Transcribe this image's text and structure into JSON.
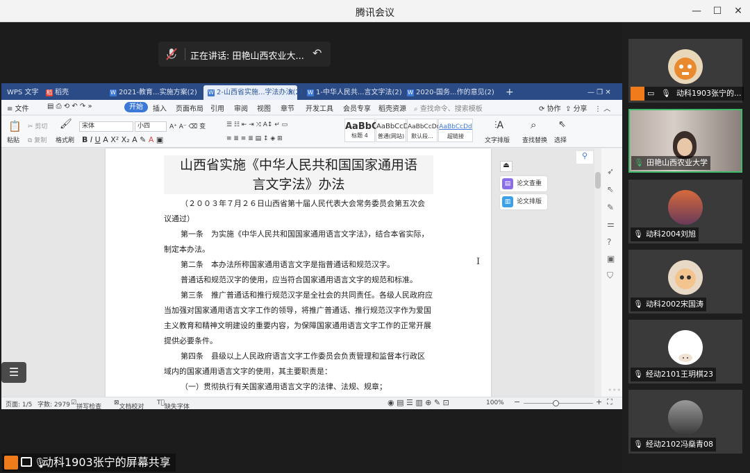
{
  "window": {
    "title": "腾讯会议",
    "minimize": "—",
    "maximize": "☐",
    "close": "✕"
  },
  "speaking": {
    "label": "正在讲话: 田艳山西农业大..."
  },
  "wps": {
    "tabs": [
      {
        "label": "WPS 文字"
      },
      {
        "label": "稻壳"
      },
      {
        "label": "2021-教育...实施方案(2)"
      },
      {
        "label": "2-山西省实施...字法办法(2)"
      },
      {
        "label": "1-中华人民共...言文字法(2)"
      },
      {
        "label": "2020-国务...作的意见(2)"
      }
    ],
    "menu": {
      "file": "≡ 文件",
      "items": [
        "开始",
        "插入",
        "页面布局",
        "引用",
        "审阅",
        "视图",
        "章节",
        "开发工具",
        "会员专享",
        "稻壳资源"
      ],
      "search": "查找命令、搜索模板",
      "collab": "协作",
      "share": "分享"
    },
    "ribbon": {
      "paste": "粘贴",
      "cut": "剪切",
      "copy": "复制",
      "format_painter": "格式刷",
      "font": "宋体",
      "size": "小四",
      "styles": [
        {
          "sample": "AaBbC",
          "name": "标题 4"
        },
        {
          "sample": "AaBbCcD",
          "name": "普通(网站)"
        },
        {
          "sample": "AaBbCcDd",
          "name": "默认段..."
        },
        {
          "sample": "AaBbCcDd",
          "name": "超链接"
        }
      ],
      "text_layout": "文字排版",
      "find_replace": "查找替换",
      "select": "选择"
    },
    "doc": {
      "title1": "山西省实施《中华人民共和国国家通用语",
      "title2": "言文字法》办法",
      "lines": [
        "（２００３年７月２６日山西省第十届人民代表大会常务委员会第五次会",
        "议通过）",
        "第一条　为实施《中华人民共和国国家通用语言文字法》，结合本省实际，",
        "制定本办法。",
        "第二条　本办法所称国家通用语言文字是指普通话和规范汉字。",
        "普通话和规范汉字的使用，应当符合国家通用语言文字的规范和标准。",
        "第三条　推广普通话和推行规范汉字是全社会的共同责任。各级人民政府应",
        "当加强对国家通用语言文字工作的领导，将推广普通话、推行规范汉字作为爱国",
        "主义教育和精神文明建设的重要内容，为保障国家通用语言文字工作的正常开展",
        "提供必要条件。",
        "第四条　县级以上人民政府语言文字工作委员会负责管理和监督本行政区",
        "域内的国家通用语言文字的使用，其主要职责是：",
        "（一）贯彻执行有关国家通用语言文字的法律、法规、规章；"
      ]
    },
    "side": {
      "check": "论文查重",
      "format": "论文排版"
    },
    "status": {
      "page": "页面: 1/5",
      "words": "字数: 2979",
      "spell": "拼写检查",
      "doc_check": "文档校对",
      "missing_font": "缺失字体",
      "zoom": "100%"
    }
  },
  "share_label": "动科1903张宁的屏幕共享",
  "participants": [
    {
      "name": "动科1903张宁的..."
    },
    {
      "name": "田艳山西农业大学"
    },
    {
      "name": "动科2004刘旭"
    },
    {
      "name": "动科2002宋国涛"
    },
    {
      "name": "经动2101王玥棋23"
    },
    {
      "name": "经动2102冯燊青08"
    }
  ],
  "colors": {
    "accent": "#3c78d8",
    "speaking_border": "#3dbb6b",
    "wps_tabbar": "#2b4b86",
    "presenter": "#f07b1a"
  }
}
